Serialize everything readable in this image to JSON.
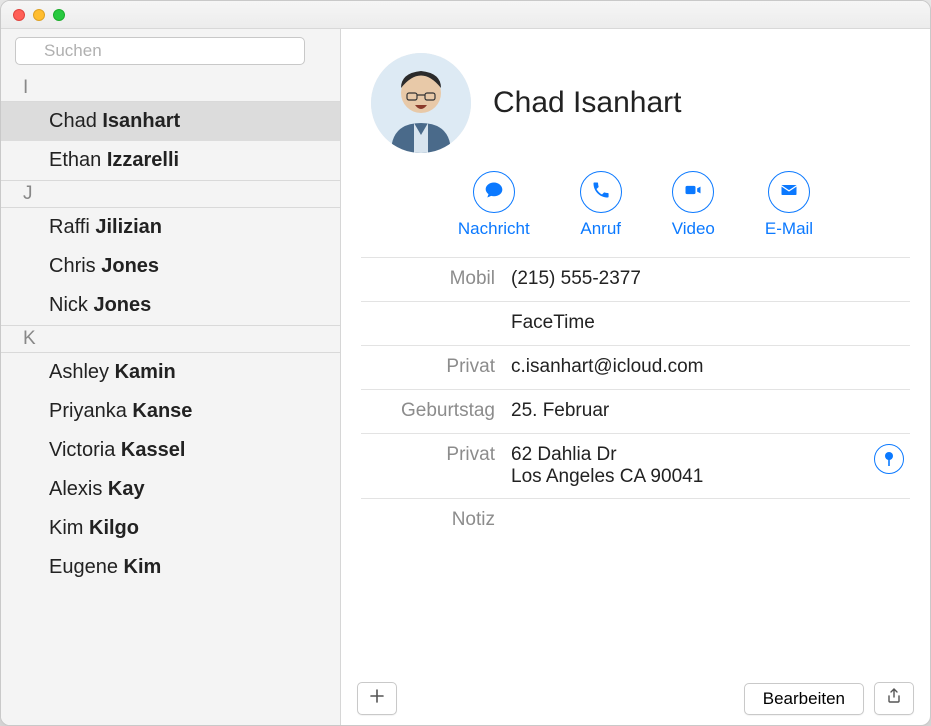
{
  "search": {
    "placeholder": "Suchen"
  },
  "sidebar": {
    "sections": [
      {
        "letter": "I",
        "items": [
          {
            "first": "Chad",
            "last": "Isanhart",
            "selected": true
          },
          {
            "first": "Ethan",
            "last": "Izzarelli",
            "selected": false
          }
        ]
      },
      {
        "letter": "J",
        "items": [
          {
            "first": "Raffi",
            "last": "Jilizian",
            "selected": false
          },
          {
            "first": "Chris",
            "last": "Jones",
            "selected": false
          },
          {
            "first": "Nick",
            "last": "Jones",
            "selected": false
          }
        ]
      },
      {
        "letter": "K",
        "items": [
          {
            "first": "Ashley",
            "last": "Kamin",
            "selected": false
          },
          {
            "first": "Priyanka",
            "last": "Kanse",
            "selected": false
          },
          {
            "first": "Victoria",
            "last": "Kassel",
            "selected": false
          },
          {
            "first": "Alexis",
            "last": "Kay",
            "selected": false
          },
          {
            "first": "Kim",
            "last": "Kilgo",
            "selected": false
          },
          {
            "first": "Eugene",
            "last": "Kim",
            "selected": false
          }
        ]
      }
    ]
  },
  "contact": {
    "name": "Chad Isanhart",
    "actions": {
      "message": "Nachricht",
      "call": "Anruf",
      "video": "Video",
      "email": "E-Mail"
    },
    "fields": [
      {
        "label": "Mobil",
        "value": "(215) 555-2377"
      },
      {
        "label": "",
        "value": "FaceTime"
      },
      {
        "label": "Privat",
        "value": "c.isanhart@icloud.com"
      },
      {
        "label": "Geburtstag",
        "value": "25. Februar"
      },
      {
        "label": "Privat",
        "value": "62 Dahlia Dr\nLos Angeles CA 90041",
        "pin": true
      },
      {
        "label": "Notiz",
        "value": ""
      }
    ]
  },
  "footer": {
    "edit": "Bearbeiten"
  }
}
